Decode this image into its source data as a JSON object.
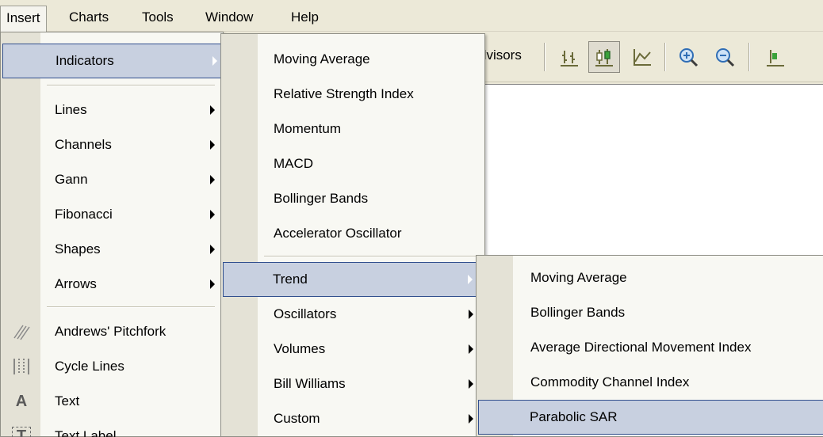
{
  "menubar": {
    "items": [
      {
        "label": "Insert"
      },
      {
        "label": "Charts"
      },
      {
        "label": "Tools"
      },
      {
        "label": "Window"
      },
      {
        "label": "Help"
      }
    ]
  },
  "toolbar": {
    "partial_label": "dvisors",
    "icons": [
      "bar-chart-icon",
      "candlestick-chart-icon",
      "line-chart-icon",
      "zoom-in-icon",
      "zoom-out-icon",
      "tile-icon"
    ]
  },
  "insert_menu": {
    "items": [
      {
        "label": "Indicators",
        "submenu": true
      },
      {
        "label": "Lines",
        "submenu": true
      },
      {
        "label": "Channels",
        "submenu": true
      },
      {
        "label": "Gann",
        "submenu": true
      },
      {
        "label": "Fibonacci",
        "submenu": true
      },
      {
        "label": "Shapes",
        "submenu": true
      },
      {
        "label": "Arrows",
        "submenu": true
      },
      {
        "label": "Andrews' Pitchfork",
        "icon": "pitchfork-icon"
      },
      {
        "label": "Cycle Lines",
        "icon": "cycle-lines-icon"
      },
      {
        "label": "Text",
        "icon": "text-icon",
        "icon_char": "A"
      },
      {
        "label": "Text Label",
        "icon": "text-label-icon",
        "icon_char": "T"
      }
    ]
  },
  "indicators_menu": {
    "items": [
      {
        "label": "Moving Average"
      },
      {
        "label": "Relative Strength Index"
      },
      {
        "label": "Momentum"
      },
      {
        "label": "MACD"
      },
      {
        "label": "Bollinger Bands"
      },
      {
        "label": "Accelerator Oscillator"
      },
      {
        "label": "Trend",
        "submenu": true
      },
      {
        "label": "Oscillators",
        "submenu": true
      },
      {
        "label": "Volumes",
        "submenu": true
      },
      {
        "label": "Bill Williams",
        "submenu": true
      },
      {
        "label": "Custom",
        "submenu": true
      }
    ]
  },
  "trend_menu": {
    "items": [
      {
        "label": "Moving Average"
      },
      {
        "label": "Bollinger Bands"
      },
      {
        "label": "Average Directional Movement Index"
      },
      {
        "label": "Commodity Channel Index"
      },
      {
        "label": "Parabolic SAR"
      }
    ]
  },
  "colors": {
    "highlight_bg": "#c8d0e0",
    "highlight_border": "#314f8e",
    "menu_bg": "#f8f8f3",
    "gutter_bg": "#e4e2d6"
  }
}
